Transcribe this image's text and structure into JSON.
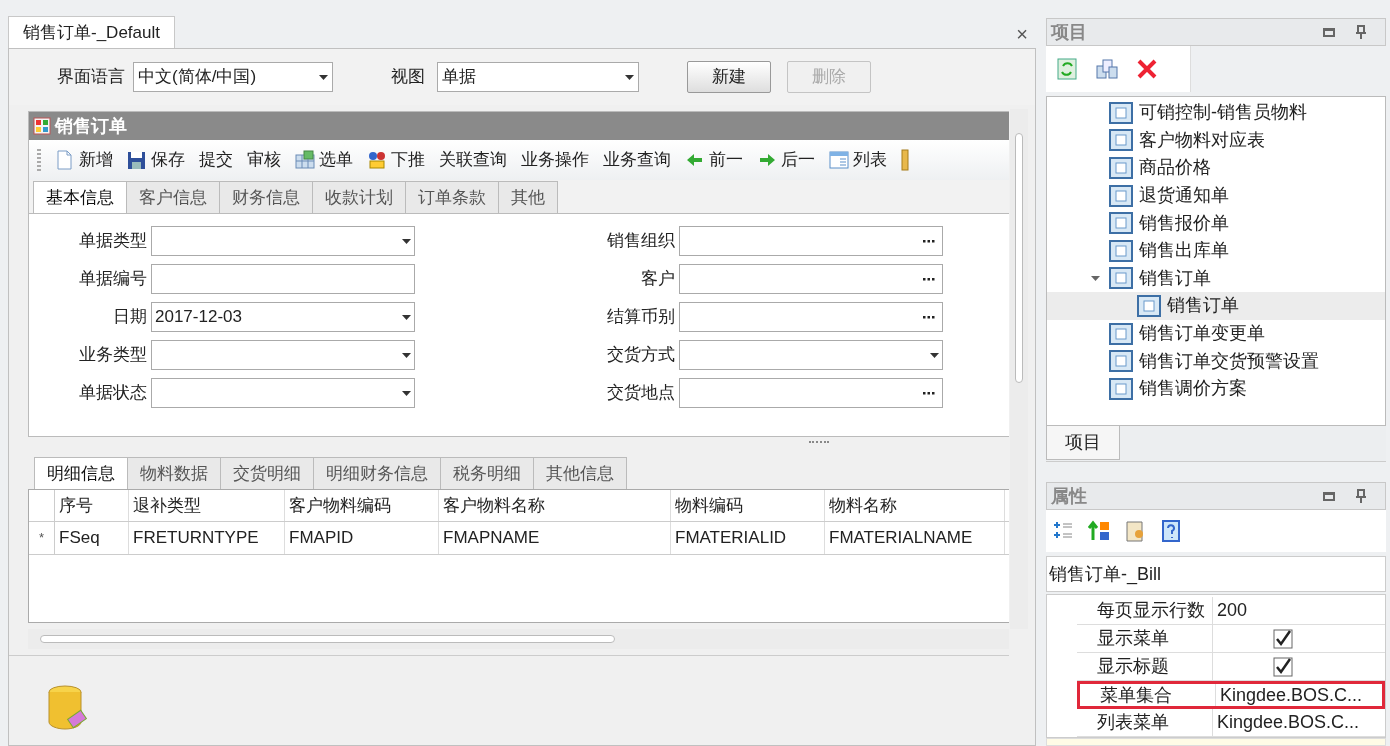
{
  "document_tab": {
    "label": "销售订单-_Default",
    "selected": true,
    "close": "×"
  },
  "top_bar": {
    "language_label": "界面语言",
    "language": "中文(简体/中国)",
    "view_label": "视图",
    "view": "单据",
    "buttons": [
      {
        "label": "新建",
        "disabled": false
      },
      {
        "label": "删除",
        "disabled": true
      }
    ]
  },
  "form": {
    "title": "销售订单",
    "toolbar": [
      {
        "label": "新增",
        "kind": "new"
      },
      {
        "label": "保存",
        "kind": "save"
      },
      {
        "label": "提交",
        "kind": "text"
      },
      {
        "label": "审核",
        "kind": "text"
      },
      {
        "label": "选单",
        "kind": "grid"
      },
      {
        "label": "下推",
        "kind": "push"
      },
      {
        "label": "关联查询",
        "kind": "text"
      },
      {
        "label": "业务操作",
        "kind": "text"
      },
      {
        "label": "业务查询",
        "kind": "text"
      },
      {
        "label": "前一",
        "kind": "prev"
      },
      {
        "label": "后一",
        "kind": "next"
      },
      {
        "label": "列表",
        "kind": "list"
      }
    ],
    "tabs": [
      {
        "label": "基本信息",
        "selected": true
      },
      {
        "label": "客户信息",
        "selected": false
      },
      {
        "label": "财务信息",
        "selected": false
      },
      {
        "label": "收款计划",
        "selected": false
      },
      {
        "label": "订单条款",
        "selected": false
      },
      {
        "label": "其他",
        "selected": false
      }
    ],
    "fields_left": [
      {
        "label": "单据类型",
        "kind": "dropdown"
      },
      {
        "label": "单据编号",
        "kind": "text"
      },
      {
        "label": "日期",
        "kind": "dropdown",
        "value": "2017-12-03"
      },
      {
        "label": "业务类型",
        "kind": "dropdown"
      },
      {
        "label": "单据状态",
        "kind": "dropdown"
      }
    ],
    "fields_right": [
      {
        "label": "销售组织",
        "kind": "lookup"
      },
      {
        "label": "客户",
        "kind": "lookup"
      },
      {
        "label": "结算币别",
        "kind": "lookup"
      },
      {
        "label": "交货方式",
        "kind": "dropdown"
      },
      {
        "label": "交货地点",
        "kind": "lookup"
      }
    ]
  },
  "detail": {
    "tabs": [
      {
        "label": "明细信息",
        "selected": true
      },
      {
        "label": "物料数据",
        "selected": false
      },
      {
        "label": "交货明细",
        "selected": false
      },
      {
        "label": "明细财务信息",
        "selected": false
      },
      {
        "label": "税务明细",
        "selected": false
      },
      {
        "label": "其他信息",
        "selected": false
      }
    ],
    "table": {
      "columns": [
        "序号",
        "退补类型",
        "客户物料编码",
        "客户物料名称",
        "物料编码",
        "物料名称"
      ],
      "rows": [
        {
          "marker": "*",
          "cells": [
            "FSeq",
            "FRETURNTYPE",
            "FMAPID",
            "FMAPNAME",
            "FMATERIALID",
            "FMATERIALNAME"
          ]
        }
      ]
    }
  },
  "project_panel": {
    "title": "项目",
    "tree": [
      {
        "label": "可销控制-销售员物料",
        "selected": false
      },
      {
        "label": "客户物料对应表",
        "selected": false
      },
      {
        "label": "商品价格",
        "selected": false
      },
      {
        "label": "退货通知单",
        "selected": false
      },
      {
        "label": "销售报价单",
        "selected": false
      },
      {
        "label": "销售出库单",
        "selected": false
      },
      {
        "label": "销售订单",
        "selected": false,
        "expanded": true,
        "children": [
          {
            "label": "销售订单",
            "selected": true
          }
        ]
      },
      {
        "label": "销售订单变更单",
        "selected": false
      },
      {
        "label": "销售订单交货预警设置",
        "selected": false
      },
      {
        "label": "销售调价方案",
        "selected": false
      }
    ],
    "bottom_tab": {
      "label": "项目",
      "selected": true
    }
  },
  "property_panel": {
    "title": "属性",
    "object": "销售订单-_Bill",
    "rows": [
      {
        "name": "每页显示行数",
        "kind": "text",
        "value": "200",
        "highlighted": false
      },
      {
        "name": "显示菜单",
        "kind": "check",
        "checked": true,
        "highlighted": false
      },
      {
        "name": "显示标题",
        "kind": "check",
        "checked": true,
        "highlighted": false
      },
      {
        "name": "菜单集合",
        "kind": "text",
        "value": "Kingdee.BOS.C...",
        "highlighted": true
      },
      {
        "name": "列表菜单",
        "kind": "text",
        "value": "Kingdee.BOS.C...",
        "highlighted": false
      }
    ]
  }
}
